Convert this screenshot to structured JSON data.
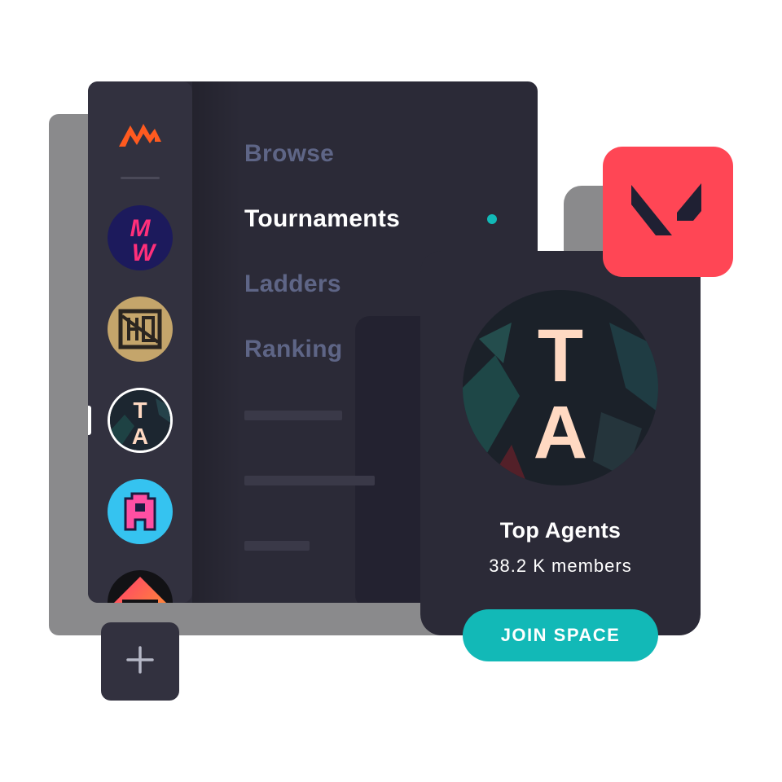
{
  "nav": {
    "items": [
      {
        "label": "Browse",
        "active": false
      },
      {
        "label": "Tournaments",
        "active": true
      },
      {
        "label": "Ladders",
        "active": false
      },
      {
        "label": "Ranking",
        "active": false
      }
    ]
  },
  "sidebar": {
    "spaces": [
      {
        "name": "MW",
        "selected": false
      },
      {
        "name": "HQ",
        "selected": false
      },
      {
        "name": "TA",
        "selected": true
      },
      {
        "name": "A",
        "selected": false
      },
      {
        "name": "OMEN",
        "selected": false
      }
    ]
  },
  "card": {
    "monogram_top": "T",
    "monogram_bottom": "A",
    "title": "Top Agents",
    "members": "38.2 K members",
    "join_label": "JOIN SPACE"
  },
  "icons": {
    "app_logo": "app-logo-icon",
    "add": "plus-icon",
    "game": "valorant-logo-icon"
  },
  "colors": {
    "accent": "#12b9b7",
    "logo": "#ff5a1f",
    "game_badge": "#ff4655",
    "panel": "#2b2a37",
    "rail": "#32313f",
    "nav_inactive": "#5e6586"
  }
}
